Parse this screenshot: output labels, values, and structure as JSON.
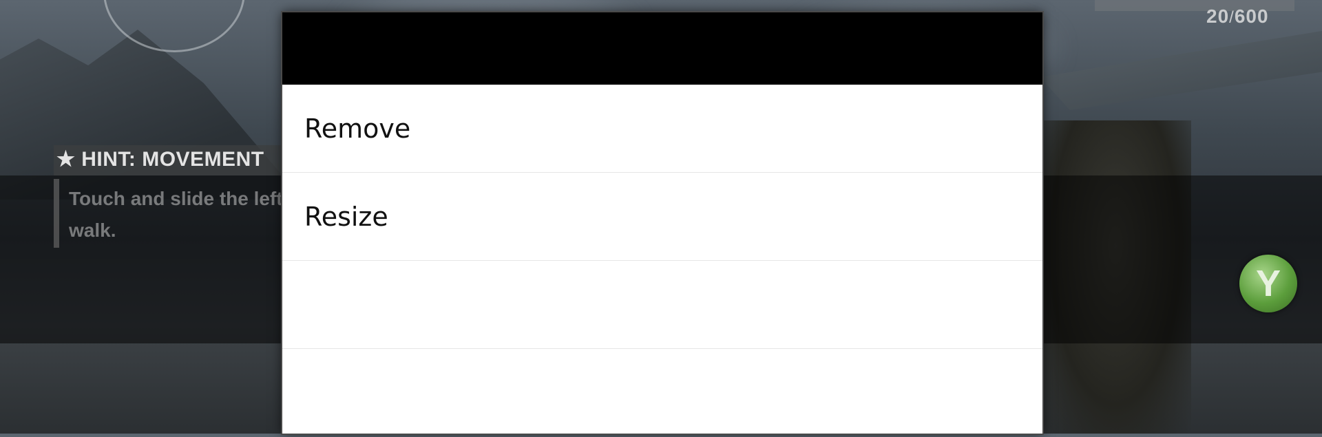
{
  "game": {
    "ammo": {
      "current": "20",
      "separator": "/",
      "max": "600"
    },
    "hint": {
      "title": "★ HINT: MOVEMENT",
      "text": "Touch and slide the left walk."
    },
    "y_button_label": "Y"
  },
  "dialog": {
    "title": "",
    "items": [
      {
        "label": "Remove"
      },
      {
        "label": "Resize"
      },
      {
        "label": ""
      },
      {
        "label": ""
      }
    ]
  }
}
